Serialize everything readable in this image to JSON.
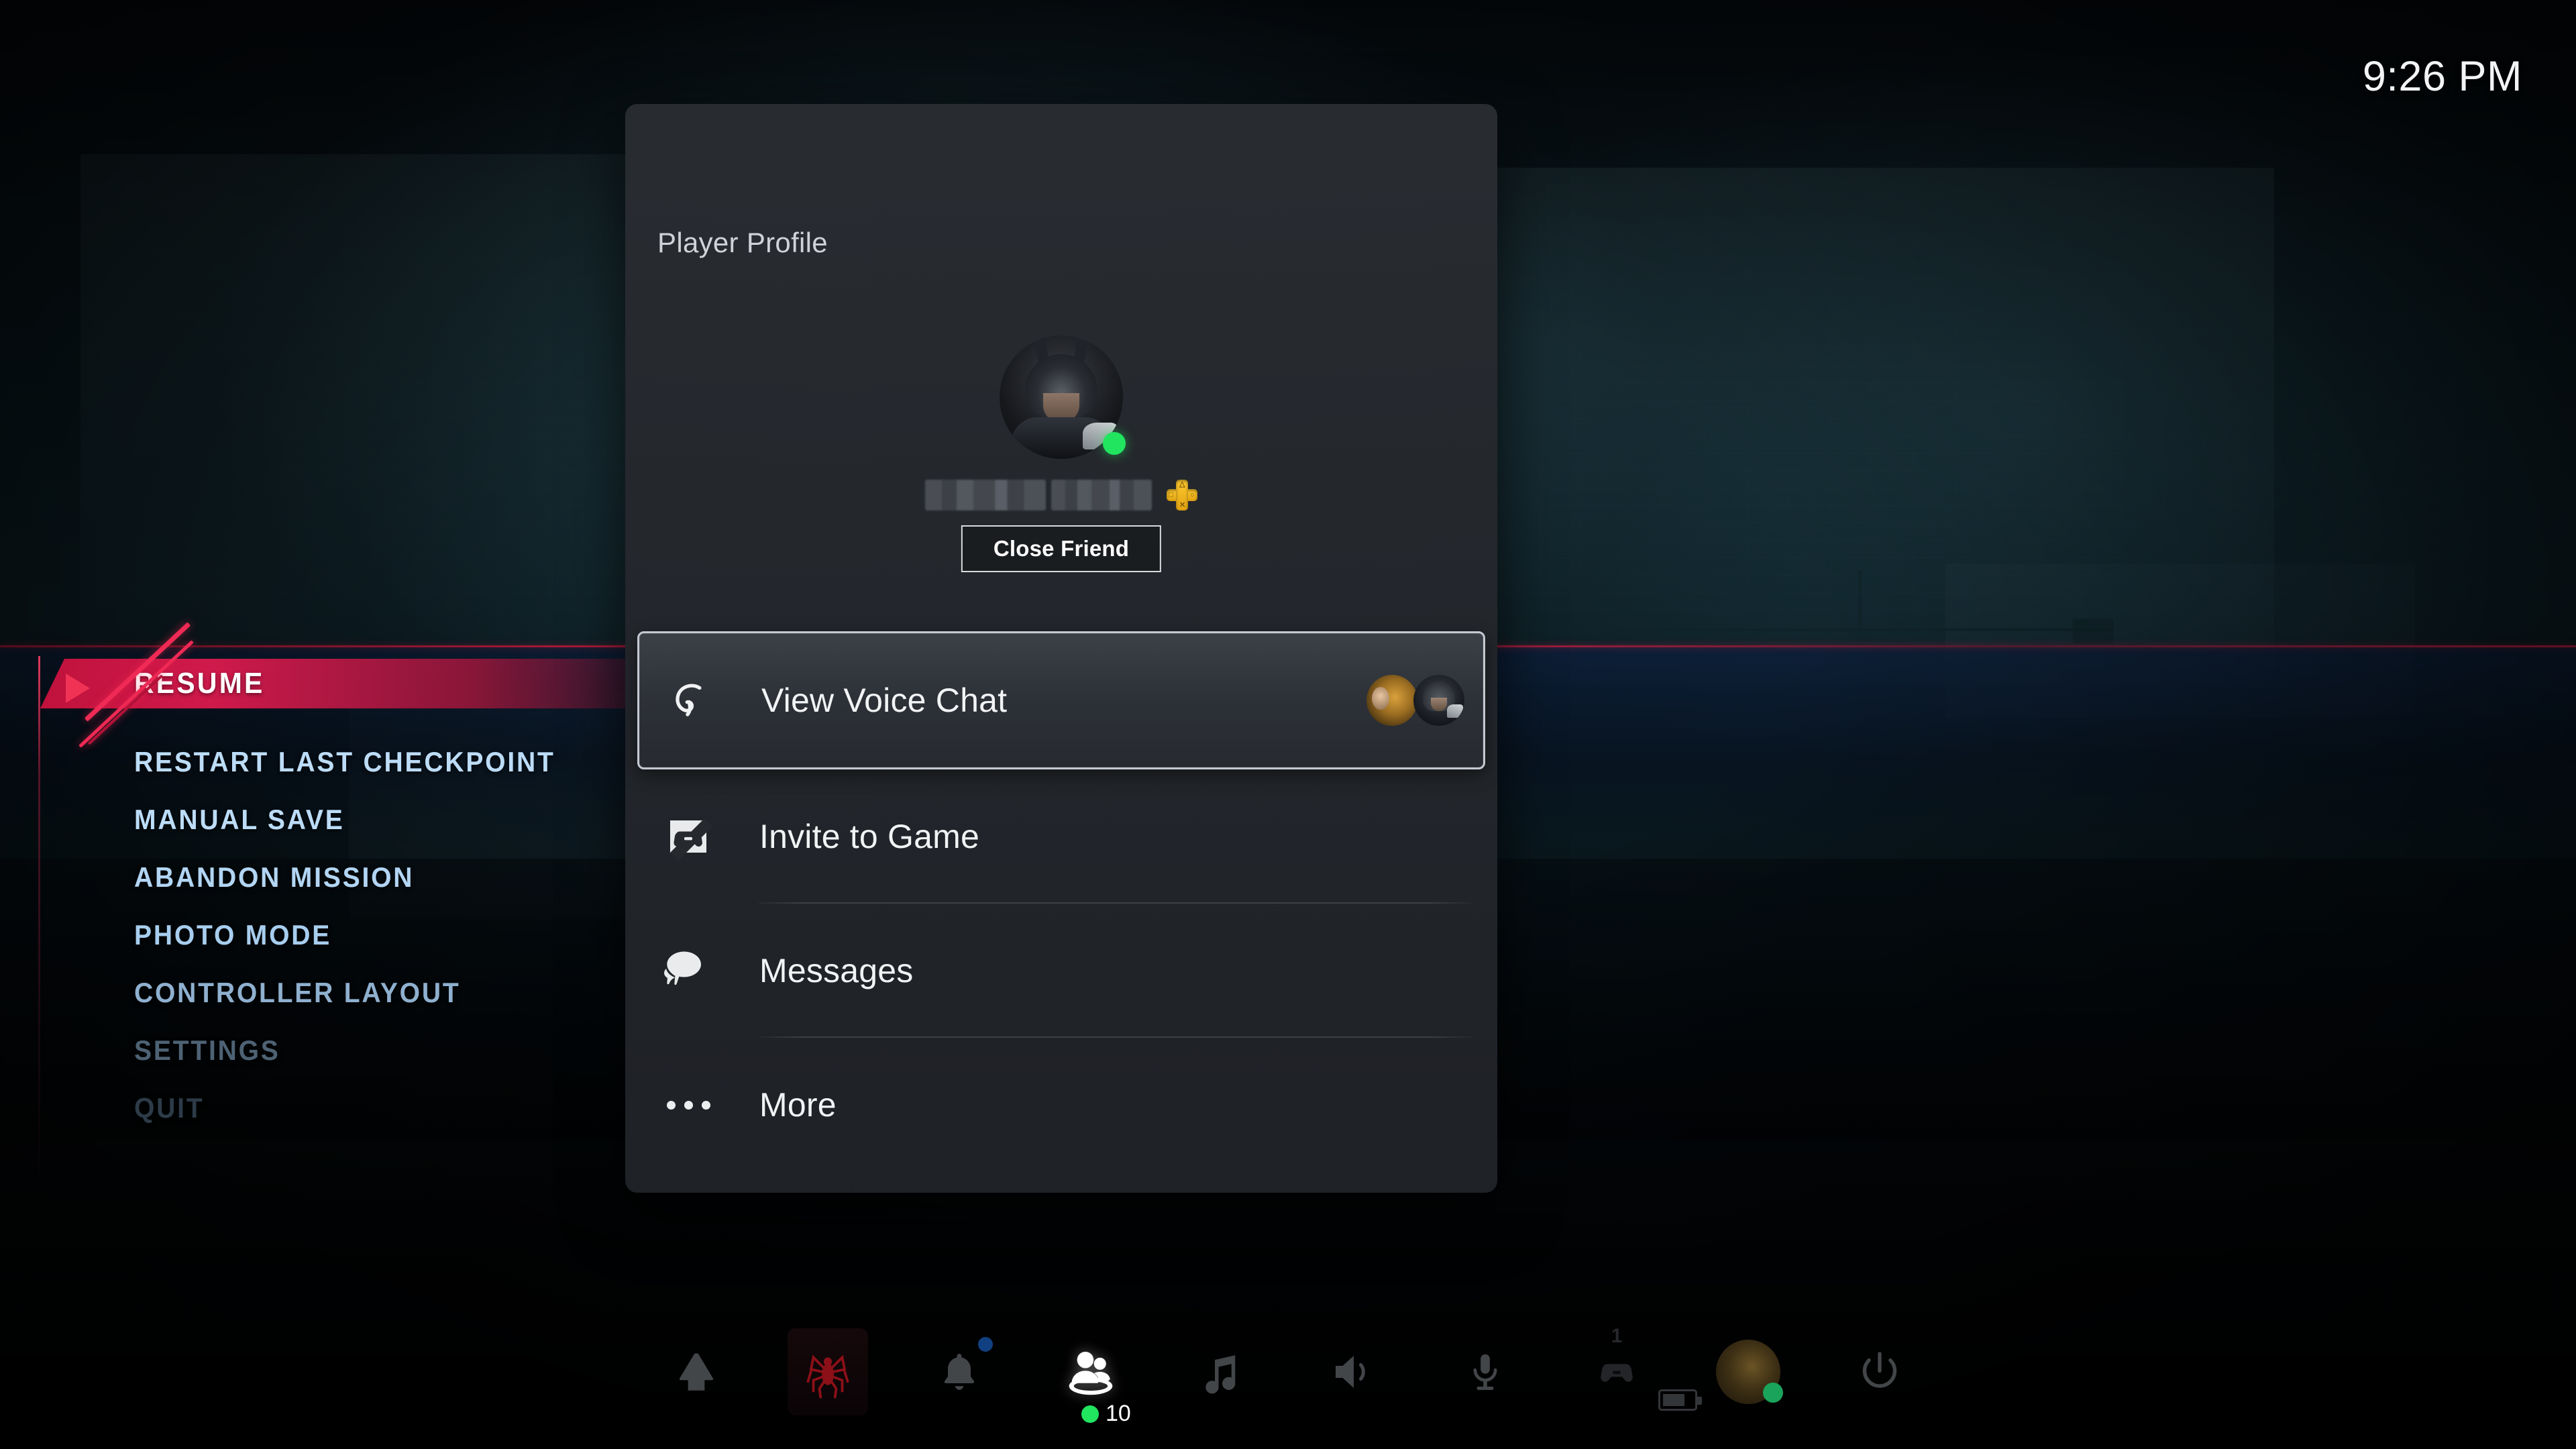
{
  "clock": {
    "time": "9:26 PM"
  },
  "pause_menu": {
    "items": [
      {
        "label": "RESUME",
        "state": "selected"
      },
      {
        "label": "RESTART LAST CHECKPOINT",
        "state": "normal"
      },
      {
        "label": "MANUAL SAVE",
        "state": "normal"
      },
      {
        "label": "ABANDON MISSION",
        "state": "normal"
      },
      {
        "label": "PHOTO MODE",
        "state": "normal"
      },
      {
        "label": "CONTROLLER LAYOUT",
        "state": "normal"
      },
      {
        "label": "SETTINGS",
        "state": "faded"
      },
      {
        "label": "QUIT",
        "state": "faded"
      }
    ],
    "accent_color": "#da1a4e"
  },
  "profile_panel": {
    "title": "Player Profile",
    "online_status": "online",
    "online_color": "#21e45f",
    "username_redacted": true,
    "ps_plus_badge": "ps-plus-icon",
    "ps_plus_color": "#fdc930",
    "relationship_button": "Close Friend",
    "menu": [
      {
        "label": "View Voice Chat",
        "icon": "headset-icon",
        "selected": true,
        "participants": 2,
        "divider": false
      },
      {
        "label": "Invite to Game",
        "icon": "game-invite-icon",
        "selected": false,
        "participants": 0,
        "divider": true
      },
      {
        "label": "Messages",
        "icon": "message-bubbles-icon",
        "selected": false,
        "participants": 0,
        "divider": true
      },
      {
        "label": "More",
        "icon": "ellipsis-icon",
        "selected": false,
        "participants": 0,
        "divider": false
      }
    ]
  },
  "taskbar": {
    "items": [
      {
        "name": "home",
        "icon": "home-icon",
        "badge": ""
      },
      {
        "name": "game-tile",
        "icon": "spider-game-icon",
        "badge": ""
      },
      {
        "name": "notifications",
        "icon": "bell-icon",
        "badge": "blue-dot"
      },
      {
        "name": "friends",
        "icon": "friends-icon",
        "badge": "10",
        "badge_dot_color": "#21e45f"
      },
      {
        "name": "music",
        "icon": "music-note-icon",
        "badge": ""
      },
      {
        "name": "sound",
        "icon": "speaker-icon",
        "badge": ""
      },
      {
        "name": "microphone",
        "icon": "microphone-icon",
        "badge": ""
      },
      {
        "name": "accessories",
        "icon": "controller-icon",
        "badge": "1"
      },
      {
        "name": "profile",
        "icon": "profile-avatar-icon",
        "badge": ""
      },
      {
        "name": "power",
        "icon": "power-icon",
        "badge": ""
      }
    ],
    "friends_count": "10",
    "controller_number": "1"
  }
}
